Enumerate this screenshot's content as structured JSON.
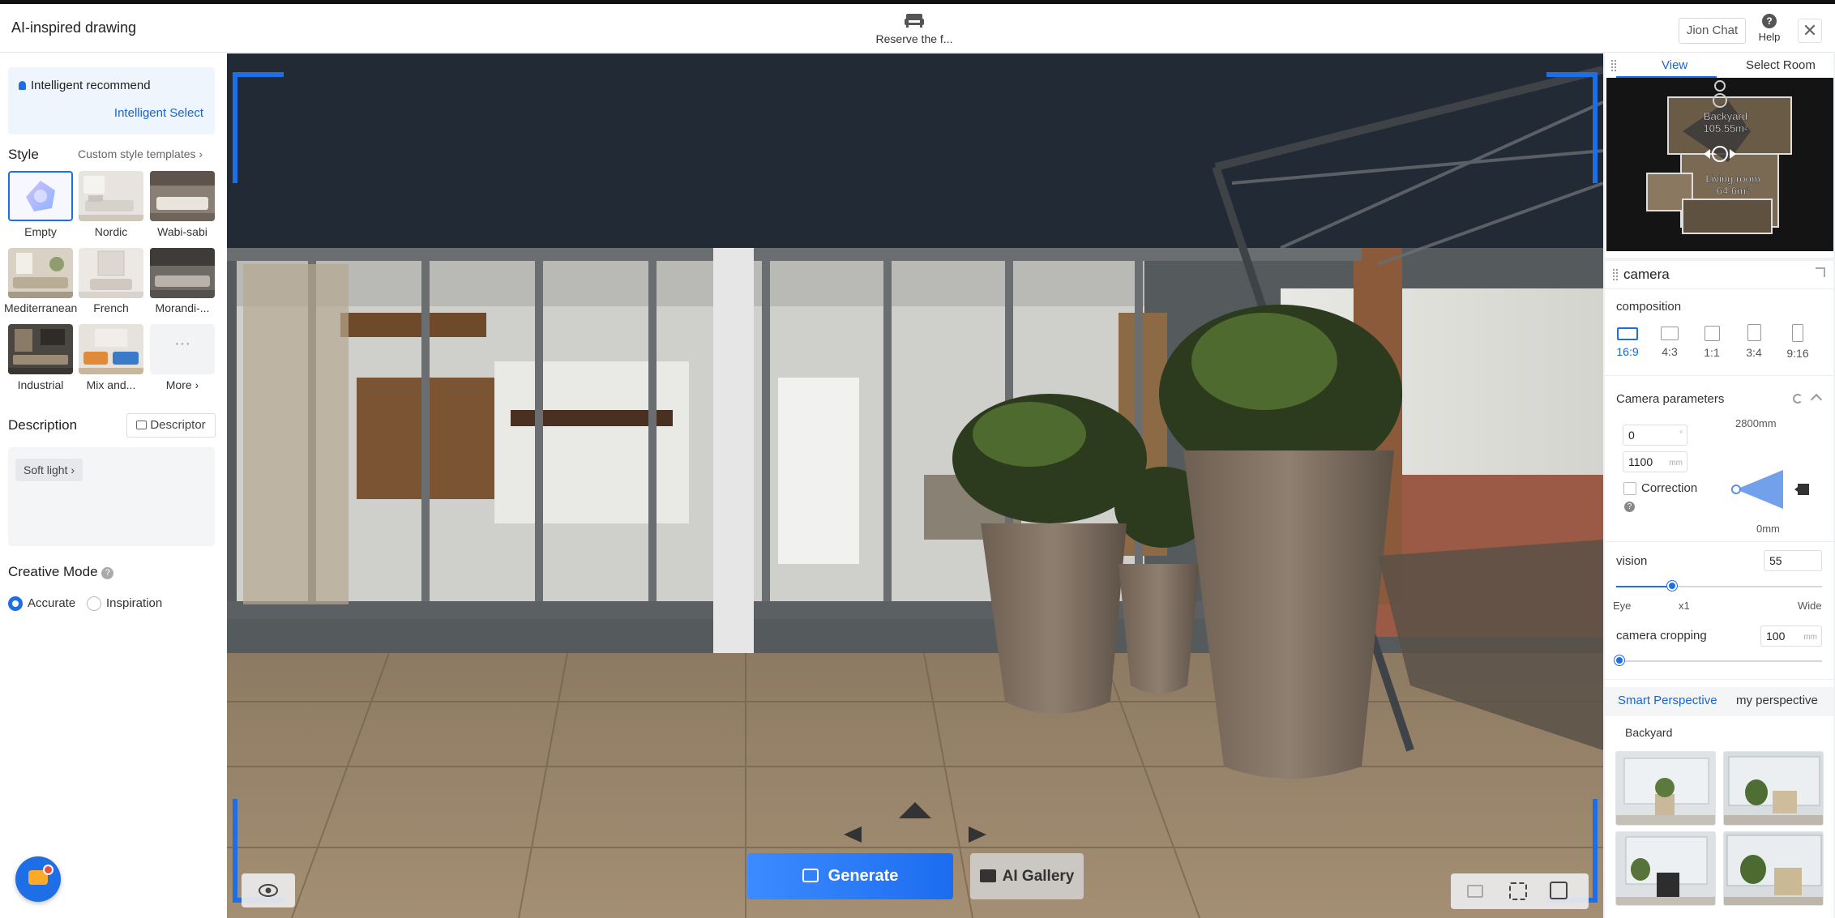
{
  "header": {
    "title": "AI-inspired drawing",
    "reserve_label": "Reserve the f...",
    "join_chat": "Jion Chat",
    "help_label": "Help",
    "close_icon": "close-icon"
  },
  "left_panel": {
    "intelligent_recommend": "Intelligent recommend",
    "intelligent_select": "Intelligent Select",
    "style_title": "Style",
    "custom_templates": "Custom style templates",
    "styles": [
      {
        "label": "Empty",
        "selected": true
      },
      {
        "label": "Nordic",
        "selected": false
      },
      {
        "label": "Wabi-sabi",
        "selected": false
      },
      {
        "label": "Mediterranean",
        "selected": false
      },
      {
        "label": "French",
        "selected": false
      },
      {
        "label": "Morandi-...",
        "selected": false
      },
      {
        "label": "Industrial",
        "selected": false
      },
      {
        "label": "Mix and...",
        "selected": false
      },
      {
        "label": "More",
        "selected": false
      }
    ],
    "description_title": "Description",
    "descriptor_button": "Descriptor",
    "description_chip": "Soft light",
    "creative_mode_title": "Creative Mode",
    "modes": [
      {
        "label": "Accurate",
        "selected": true
      },
      {
        "label": "Inspiration",
        "selected": false
      }
    ]
  },
  "viewport": {
    "generate_label": "Generate",
    "gallery_label": "AI Gallery"
  },
  "right_panel": {
    "tabs": [
      {
        "label": "View",
        "active": true
      },
      {
        "label": "Select Room",
        "active": false
      }
    ],
    "minimap": {
      "room1_name": "Backyard",
      "room1_area": "105.55m²",
      "room2_name": "Living room",
      "room2_area": "64.6m²"
    },
    "camera_title": "camera",
    "composition_title": "composition",
    "ratios": [
      {
        "label": "16:9",
        "active": true
      },
      {
        "label": "4:3",
        "active": false
      },
      {
        "label": "1:1",
        "active": false
      },
      {
        "label": "3:4",
        "active": false
      },
      {
        "label": "9:16",
        "active": false
      }
    ],
    "camera_params_title": "Camera parameters",
    "angle_value": "0",
    "angle_unit": "°",
    "height_value": "1100",
    "height_unit": "mm",
    "height_max": "2800mm",
    "height_min": "0mm",
    "correction_label": "Correction",
    "correction_checked": false,
    "vision_label": "vision",
    "vision_value": "55",
    "vision_eye": "Eye",
    "vision_x1": "x1",
    "vision_wide": "Wide",
    "vision_level": 0.27,
    "cropping_label": "camera cropping",
    "cropping_value": "100",
    "cropping_unit": "mm",
    "cropping_level": 0.0,
    "perspective_tabs": [
      {
        "label": "Smart Perspective",
        "active": true
      },
      {
        "label": "my perspective",
        "active": false
      }
    ],
    "room_label": "Backyard"
  },
  "colors": {
    "accent": "#1e6ee6",
    "link": "#1565d8"
  }
}
